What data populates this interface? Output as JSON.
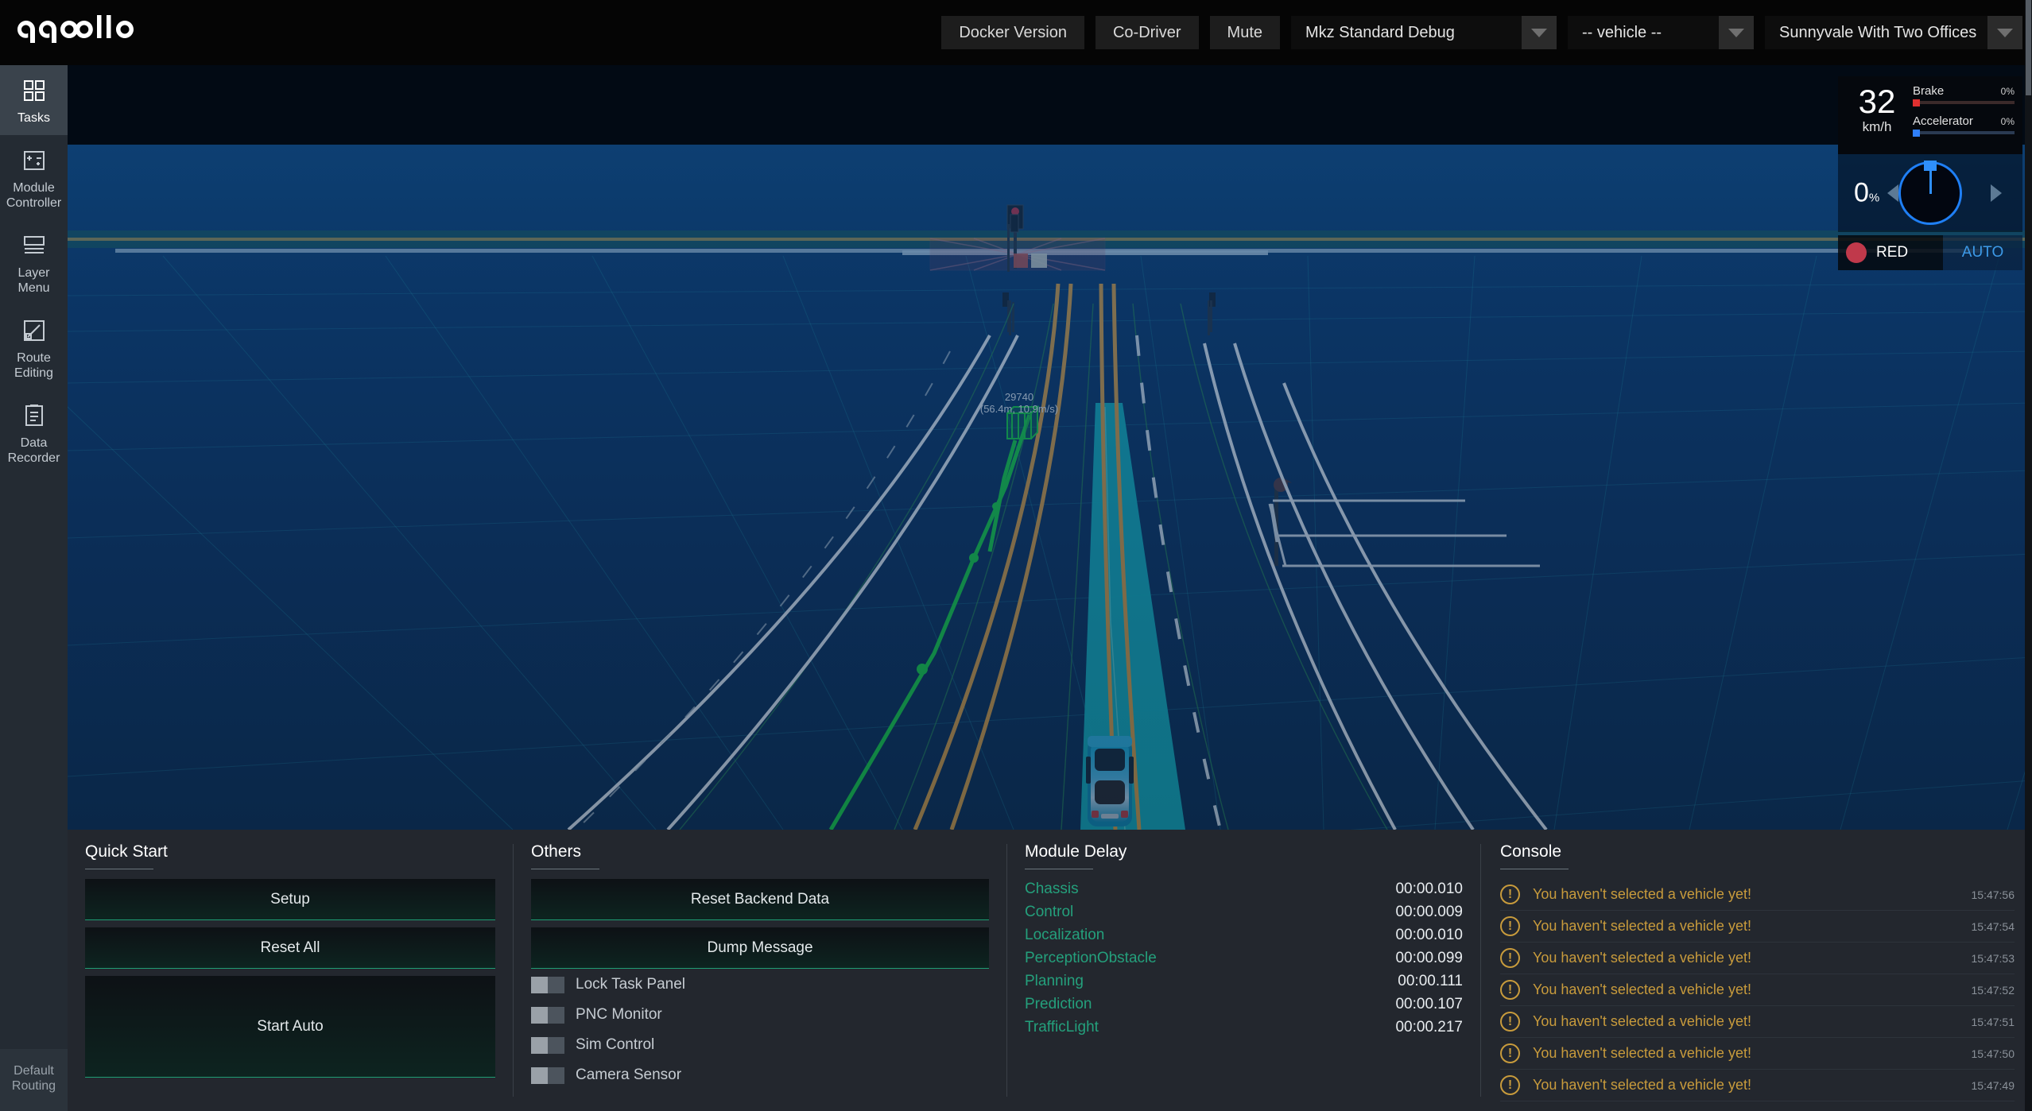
{
  "header": {
    "logo_text": "apollo",
    "buttons": [
      {
        "label": "Docker Version",
        "name": "docker-version-button"
      },
      {
        "label": "Co-Driver",
        "name": "co-driver-button"
      },
      {
        "label": "Mute",
        "name": "mute-button"
      }
    ],
    "selects": [
      {
        "name": "mode-select",
        "value": "Mkz Standard Debug"
      },
      {
        "name": "vehicle-select",
        "value": "-- vehicle --"
      },
      {
        "name": "map-select",
        "value": "Sunnyvale With Two Offices"
      }
    ]
  },
  "sidebar": {
    "items": [
      {
        "label": "Tasks",
        "icon": "tasks-icon",
        "active": true
      },
      {
        "label": "Module Controller",
        "icon": "module-controller-icon",
        "active": false
      },
      {
        "label": "Layer Menu",
        "icon": "layer-menu-icon",
        "active": false
      },
      {
        "label": "Route Editing",
        "icon": "route-editing-icon",
        "active": false
      },
      {
        "label": "Data Recorder",
        "icon": "data-recorder-icon",
        "active": false
      }
    ],
    "bottom_label": "Default Routing"
  },
  "hud": {
    "speed_value": "32",
    "speed_unit": "km/h",
    "brake_label": "Brake",
    "brake_percent": "0%",
    "accelerator_label": "Accelerator",
    "accelerator_percent": "0%",
    "steering_value": "0",
    "steering_unit": "%",
    "traffic_light": "RED",
    "driving_mode": "AUTO"
  },
  "scene": {
    "obstacle_label_id": "29740",
    "obstacle_label_info": "(56.4m, 10.9m/s)",
    "colors": {
      "sky": "#020a14",
      "ground": "#0b3565",
      "planned_path": "#18c8c8",
      "route_line": "#19e03c",
      "lane_solid_white": "#ffffff",
      "lane_double_yellow": "#f0a83c",
      "obstacle_green": "#19e03c",
      "crosswalk_red": "#c0394b"
    }
  },
  "quick_start": {
    "title": "Quick Start",
    "buttons": [
      {
        "label": "Setup",
        "name": "setup-button"
      },
      {
        "label": "Reset All",
        "name": "reset-all-button"
      },
      {
        "label": "Start Auto",
        "name": "start-auto-button"
      }
    ]
  },
  "others": {
    "title": "Others",
    "buttons": [
      {
        "label": "Reset Backend Data",
        "name": "reset-backend-data-button"
      },
      {
        "label": "Dump Message",
        "name": "dump-message-button"
      }
    ],
    "toggles": [
      {
        "label": "Lock Task Panel",
        "on": false
      },
      {
        "label": "PNC Monitor",
        "on": false
      },
      {
        "label": "Sim Control",
        "on": false
      },
      {
        "label": "Camera Sensor",
        "on": false
      }
    ]
  },
  "module_delay": {
    "title": "Module Delay",
    "rows": [
      {
        "name": "Chassis",
        "value": "00:00.010"
      },
      {
        "name": "Control",
        "value": "00:00.009"
      },
      {
        "name": "Localization",
        "value": "00:00.010"
      },
      {
        "name": "PerceptionObstacle",
        "value": "00:00.099"
      },
      {
        "name": "Planning",
        "value": "00:00.111"
      },
      {
        "name": "Prediction",
        "value": "00:00.107"
      },
      {
        "name": "TrafficLight",
        "value": "00:00.217"
      }
    ]
  },
  "console": {
    "title": "Console",
    "rows": [
      {
        "message": "You haven't selected a vehicle yet!",
        "time": "15:47:56"
      },
      {
        "message": "You haven't selected a vehicle yet!",
        "time": "15:47:54"
      },
      {
        "message": "You haven't selected a vehicle yet!",
        "time": "15:47:53"
      },
      {
        "message": "You haven't selected a vehicle yet!",
        "time": "15:47:52"
      },
      {
        "message": "You haven't selected a vehicle yet!",
        "time": "15:47:51"
      },
      {
        "message": "You haven't selected a vehicle yet!",
        "time": "15:47:50"
      },
      {
        "message": "You haven't selected a vehicle yet!",
        "time": "15:47:49"
      }
    ]
  }
}
